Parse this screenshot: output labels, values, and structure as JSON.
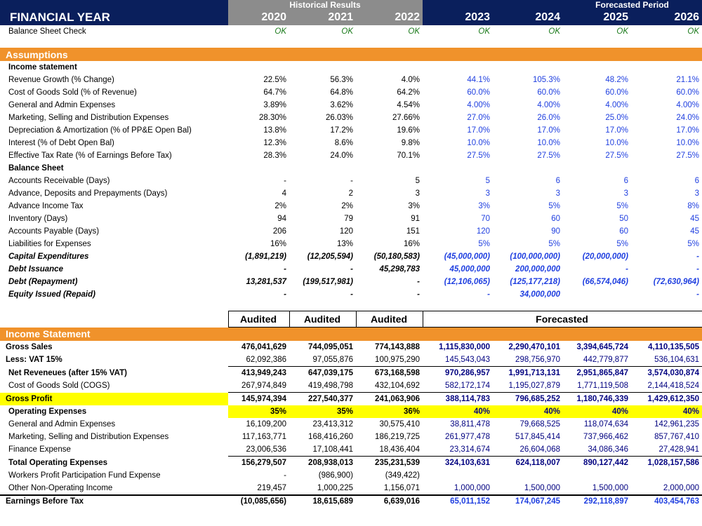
{
  "years": [
    "2020",
    "2021",
    "2022",
    "2023",
    "2024",
    "2025",
    "2026"
  ],
  "header": {
    "historical": "Historical Results",
    "forecasted": "Forecasted Period",
    "financial_year": "FINANCIAL YEAR"
  },
  "balance_check": {
    "label": "Balance Sheet Check",
    "values": [
      "OK",
      "OK",
      "OK",
      "OK",
      "OK",
      "OK",
      "OK"
    ]
  },
  "assumptions": {
    "title": "Assumptions",
    "income_statement": "Income statement",
    "rows1": [
      {
        "label": "Revenue Growth (% Change)",
        "values": [
          "22.5%",
          "56.3%",
          "4.0%",
          "44.1%",
          "105.3%",
          "48.2%",
          "21.1%"
        ]
      },
      {
        "label": "Cost of Goods Sold (% of Revenue)",
        "values": [
          "64.7%",
          "64.8%",
          "64.2%",
          "60.0%",
          "60.0%",
          "60.0%",
          "60.0%"
        ]
      },
      {
        "label": "General and Admin Expenses",
        "values": [
          "3.89%",
          "3.62%",
          "4.54%",
          "4.00%",
          "4.00%",
          "4.00%",
          "4.00%"
        ]
      },
      {
        "label": "Marketing, Selling and Distribution Expenses",
        "values": [
          "28.30%",
          "26.03%",
          "27.66%",
          "27.0%",
          "26.0%",
          "25.0%",
          "24.0%"
        ]
      },
      {
        "label": "Depreciation & Amortization (% of PP&E Open Bal)",
        "values": [
          "13.8%",
          "17.2%",
          "19.6%",
          "17.0%",
          "17.0%",
          "17.0%",
          "17.0%"
        ]
      },
      {
        "label": "Interest (% of Debt Open Bal)",
        "values": [
          "12.3%",
          "8.6%",
          "9.8%",
          "10.0%",
          "10.0%",
          "10.0%",
          "10.0%"
        ]
      },
      {
        "label": "Effective Tax Rate (% of Earnings Before Tax)",
        "values": [
          "28.3%",
          "24.0%",
          "70.1%",
          "27.5%",
          "27.5%",
          "27.5%",
          "27.5%"
        ]
      }
    ],
    "balance_sheet": "Balance Sheet",
    "rows2": [
      {
        "label": "Accounts Receivable (Days)",
        "values": [
          "-",
          "-",
          "5",
          "5",
          "6",
          "6",
          "6"
        ]
      },
      {
        "label": "Advance, Deposits and Prepayments (Days)",
        "values": [
          "4",
          "2",
          "3",
          "3",
          "3",
          "3",
          "3"
        ]
      },
      {
        "label": "Advance Income Tax",
        "values": [
          "2%",
          "2%",
          "3%",
          "3%",
          "5%",
          "5%",
          "8%"
        ]
      },
      {
        "label": "Inventory (Days)",
        "values": [
          "94",
          "79",
          "91",
          "70",
          "60",
          "50",
          "45"
        ]
      },
      {
        "label": "Accounts Payable (Days)",
        "values": [
          "206",
          "120",
          "151",
          "120",
          "90",
          "60",
          "45"
        ]
      },
      {
        "label": "Liabilities for Expenses",
        "values": [
          "16%",
          "13%",
          "16%",
          "5%",
          "5%",
          "5%",
          "5%"
        ]
      }
    ],
    "rows3": [
      {
        "label": "Capital Expenditures",
        "values": [
          "(1,891,219)",
          "(12,205,594)",
          "(50,180,583)",
          "(45,000,000)",
          "(100,000,000)",
          "(20,000,000)",
          "-"
        ]
      },
      {
        "label": "Debt Issuance",
        "values": [
          "-",
          "-",
          "45,298,783",
          "45,000,000",
          "200,000,000",
          "-",
          "-"
        ]
      },
      {
        "label": "Debt (Repayment)",
        "values": [
          "13,281,537",
          "(199,517,981)",
          "-",
          "(12,106,065)",
          "(125,177,218)",
          "(66,574,046)",
          "(72,630,964)"
        ]
      },
      {
        "label": "Equity Issued (Repaid)",
        "values": [
          "-",
          "-",
          "-",
          "-",
          "34,000,000",
          "",
          "-"
        ]
      }
    ]
  },
  "audit_header": {
    "audited": [
      "Audited",
      "Audited",
      "Audited"
    ],
    "forecasted": "Forecasted"
  },
  "income_statement": {
    "title": "Income Statement",
    "gross_sales": {
      "label": "Gross Sales",
      "values": [
        "476,041,629",
        "744,095,051",
        "774,143,888",
        "1,115,830,000",
        "2,290,470,101",
        "3,394,645,724",
        "4,110,135,505"
      ]
    },
    "vat": {
      "label": "Less: VAT 15%",
      "values": [
        "62,092,386",
        "97,055,876",
        "100,975,290",
        "145,543,043",
        "298,756,970",
        "442,779,877",
        "536,104,631"
      ]
    },
    "net_rev": {
      "label": "Net Reveneues (after 15% VAT)",
      "values": [
        "413,949,243",
        "647,039,175",
        "673,168,598",
        "970,286,957",
        "1,991,713,131",
        "2,951,865,847",
        "3,574,030,874"
      ]
    },
    "cogs": {
      "label": "Cost of Goods Sold (COGS)",
      "values": [
        "267,974,849",
        "419,498,798",
        "432,104,692",
        "582,172,174",
        "1,195,027,879",
        "1,771,119,508",
        "2,144,418,524"
      ]
    },
    "gross_profit": {
      "label": "Gross Profit",
      "values": [
        "145,974,394",
        "227,540,377",
        "241,063,906",
        "388,114,783",
        "796,685,252",
        "1,180,746,339",
        "1,429,612,350"
      ]
    },
    "opex": {
      "label": "Operating Expenses",
      "values": [
        "35%",
        "35%",
        "36%",
        "40%",
        "40%",
        "40%",
        "40%"
      ]
    },
    "ga": {
      "label": "General and Admin Expenses",
      "values": [
        "16,109,200",
        "23,413,312",
        "30,575,410",
        "38,811,478",
        "79,668,525",
        "118,074,634",
        "142,961,235"
      ]
    },
    "msd": {
      "label": "Marketing, Selling and Distribution Expenses",
      "values": [
        "117,163,771",
        "168,416,260",
        "186,219,725",
        "261,977,478",
        "517,845,414",
        "737,966,462",
        "857,767,410"
      ]
    },
    "fin": {
      "label": "Finance Expense",
      "values": [
        "23,006,536",
        "17,108,441",
        "18,436,404",
        "23,314,674",
        "26,604,068",
        "34,086,346",
        "27,428,941"
      ]
    },
    "total_opex": {
      "label": "Total Operating Expenses",
      "values": [
        "156,279,507",
        "208,938,013",
        "235,231,539",
        "324,103,631",
        "624,118,007",
        "890,127,442",
        "1,028,157,586"
      ]
    },
    "wppf": {
      "label": "Workers Profit Participation Fund Expense",
      "values": [
        "-",
        "(986,900)",
        "(349,422)",
        "",
        "",
        "",
        ""
      ]
    },
    "other_inc": {
      "label": "Other Non-Operating Income",
      "values": [
        "219,457",
        "1,000,225",
        "1,156,071",
        "1,000,000",
        "1,500,000",
        "1,500,000",
        "2,000,000"
      ]
    },
    "ebt": {
      "label": "Earnings Before Tax",
      "values": [
        "(10,085,656)",
        "18,615,689",
        "6,639,016",
        "65,011,152",
        "174,067,245",
        "292,118,897",
        "403,454,763"
      ]
    }
  },
  "colors": {
    "navy": "#0a1f5c",
    "grey": "#8c8c8c",
    "orange": "#f0922b",
    "yellow": "#ffff00",
    "input_blue": "#1f3fe0",
    "ok_green": "#1b7a1b"
  }
}
